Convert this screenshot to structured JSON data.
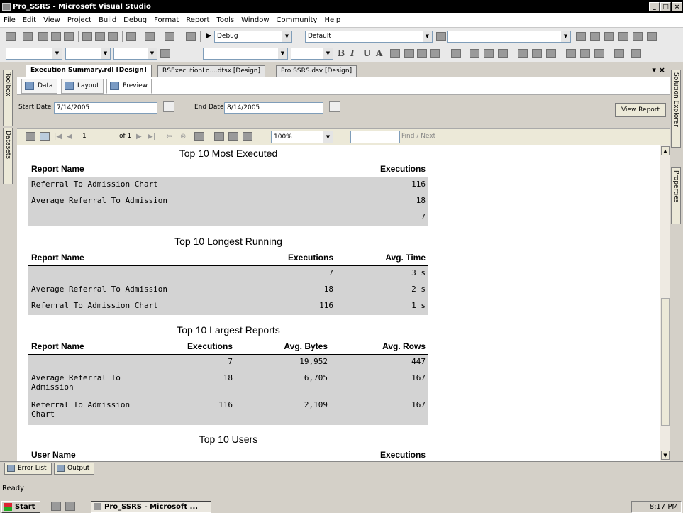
{
  "window": {
    "title": "Pro_SSRS - Microsoft Visual Studio",
    "min": "_",
    "max": "□",
    "close": "×"
  },
  "menu": [
    "File",
    "Edit",
    "View",
    "Project",
    "Build",
    "Debug",
    "Format",
    "Report",
    "Tools",
    "Window",
    "Community",
    "Help"
  ],
  "toolbar": {
    "config": "Debug",
    "platform": "Default",
    "bold": "B",
    "italic": "I",
    "underline": "U",
    "fontcolor": "A"
  },
  "left_panel": {
    "toolbox": "Toolbox",
    "datasets": "Datasets"
  },
  "right_panel": {
    "solution_explorer": "Solution Explorer",
    "properties": "Properties"
  },
  "doc_tabs": [
    "Execution Summary.rdl [Design]",
    "RSExecutionLo....dtsx [Design]",
    "Pro SSRS.dsv [Design]"
  ],
  "doc_tab_close": "▾ ×",
  "sub_tabs": [
    "Data",
    "Layout",
    "Preview"
  ],
  "params": {
    "start_label": "Start Date",
    "start_value": "7/14/2005",
    "end_label": "End Date",
    "end_value": "8/14/2005",
    "view_report": "View Report"
  },
  "nav": {
    "page": "1",
    "of": "of 1",
    "zoom": "100%",
    "find_next": "Find / Next"
  },
  "report": {
    "most_executed": {
      "title": "Top 10 Most Executed",
      "headers": [
        "Report Name",
        "Executions"
      ],
      "rows": [
        [
          "Referral To Admission Chart",
          "116"
        ],
        [
          "Average Referral To Admission",
          "18"
        ],
        [
          "",
          "7"
        ]
      ]
    },
    "longest_running": {
      "title": "Top 10 Longest Running",
      "headers": [
        "Report Name",
        "Executions",
        "Avg. Time"
      ],
      "rows": [
        [
          "",
          "7",
          "3 s"
        ],
        [
          "Average Referral To Admission",
          "18",
          "2 s"
        ],
        [
          "Referral To Admission Chart",
          "116",
          "1 s"
        ]
      ]
    },
    "largest_reports": {
      "title": "Top 10 Largest Reports",
      "headers": [
        "Report Name",
        "Executions",
        "Avg. Bytes",
        "Avg. Rows"
      ],
      "rows": [
        [
          "",
          "7",
          "19,952",
          "447"
        ],
        [
          "Average Referral To Admission",
          "18",
          "6,705",
          "167"
        ],
        [
          "Referral To Admission Chart",
          "116",
          "2,109",
          "167"
        ]
      ]
    },
    "users": {
      "title": "Top 10 Users",
      "headers": [
        "User Name",
        "Executions"
      ]
    }
  },
  "bottom_tabs": [
    "Error List",
    "Output"
  ],
  "status": "Ready",
  "taskbar": {
    "start": "Start",
    "item": "Pro_SSRS - Microsoft ...",
    "clock": "8:17 PM"
  }
}
